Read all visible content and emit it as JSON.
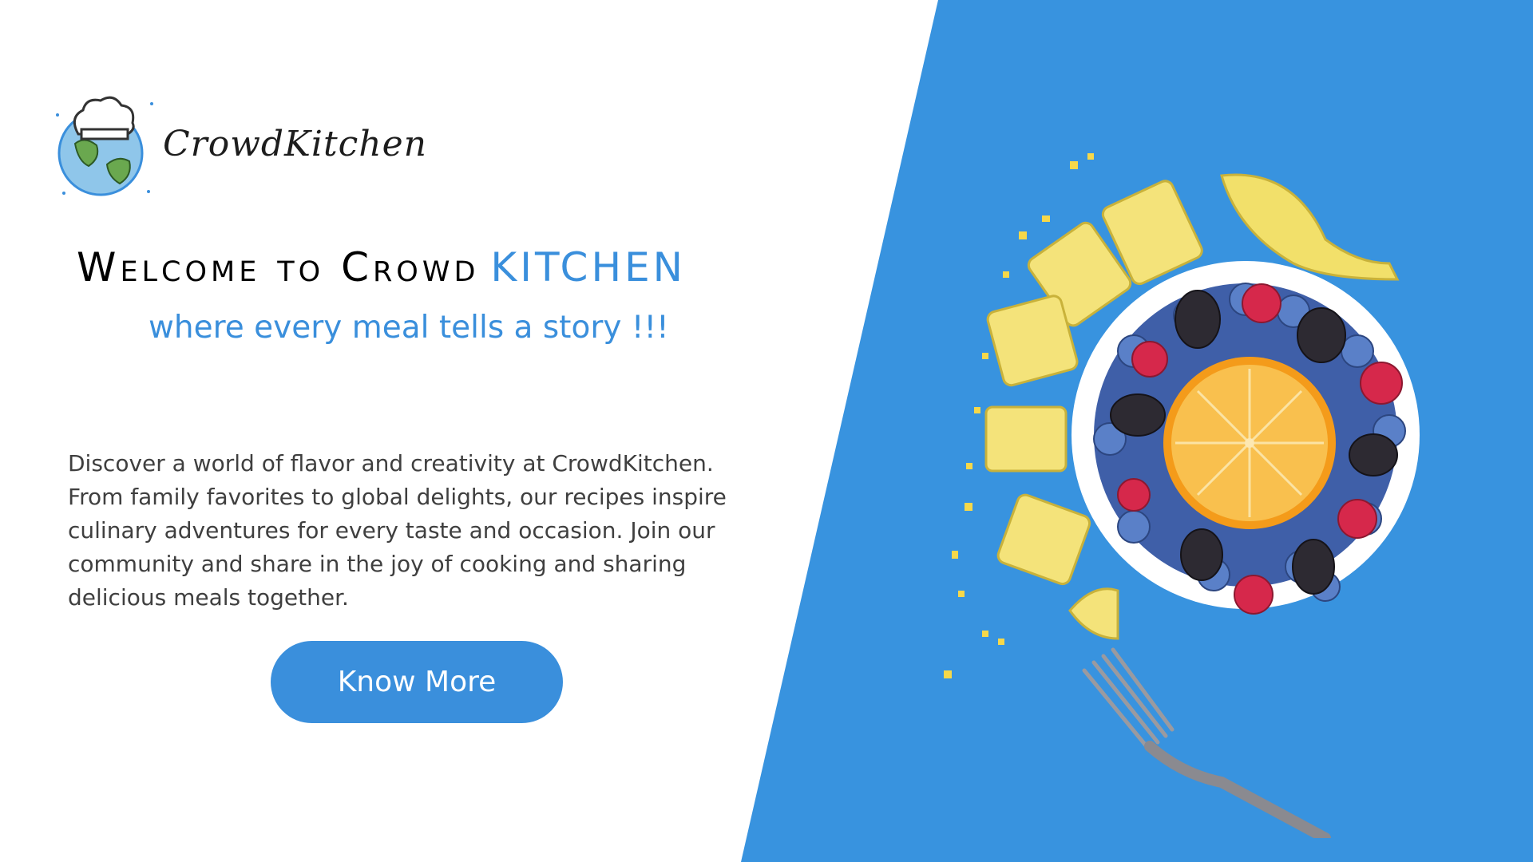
{
  "brand": {
    "logo_icon": "chef-hat-globe-icon",
    "name": "CrowdKitchen"
  },
  "hero": {
    "headline_main": "Welcome to Crowd",
    "headline_accent": "KITCHEN",
    "tagline": "where every meal tells a story !!!",
    "description": "Discover a world of flavor and creativity at CrowdKitchen. From family favorites to global delights, our recipes inspire culinary adventures for every taste and occasion. Join our community and share in the joy of cooking and sharing delicious meals together.",
    "cta_label": "Know More"
  },
  "image": {
    "subject": "fruit-bowl-illustration",
    "items": [
      "banana-slices",
      "bowl-of-berries",
      "orange-half",
      "fork"
    ]
  },
  "colors": {
    "accent": "#3a8fdc",
    "panel": "#3893df",
    "text_dark": "#000000",
    "text_body": "#3f3f3f",
    "background": "#ffffff"
  }
}
